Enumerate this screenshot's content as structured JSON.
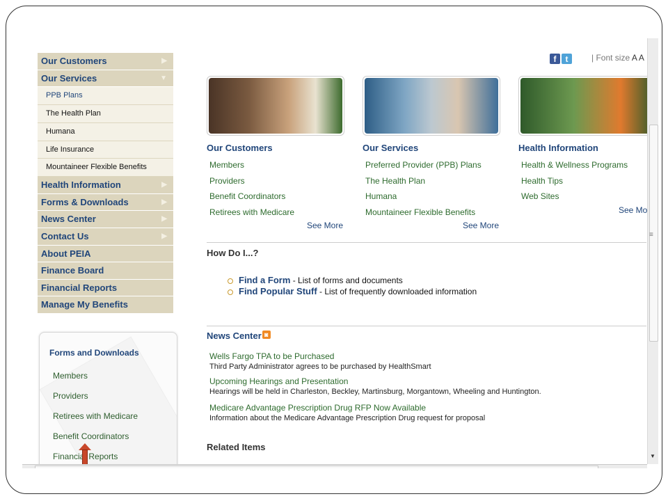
{
  "nav": {
    "items": [
      {
        "label": "Our Customers",
        "arrow": "▶"
      },
      {
        "label": "Our Services",
        "arrow": "▼"
      }
    ],
    "sub_items": [
      "PPB Plans",
      "The Health Plan",
      "Humana",
      "Life Insurance",
      "Mountaineer Flexible Benefits"
    ],
    "items_after": [
      {
        "label": "Health Information",
        "arrow": "▶"
      },
      {
        "label": "Forms & Downloads",
        "arrow": "▶"
      },
      {
        "label": "News Center",
        "arrow": "▶"
      },
      {
        "label": "Contact Us",
        "arrow": "▶"
      },
      {
        "label": "About PEIA",
        "arrow": ""
      },
      {
        "label": "Finance Board",
        "arrow": ""
      },
      {
        "label": "Financial Reports",
        "arrow": ""
      },
      {
        "label": "Manage My Benefits",
        "arrow": ""
      }
    ]
  },
  "forms_box": {
    "title": "Forms and Downloads",
    "links": [
      "Members",
      "Providers",
      "Retirees with Medicare",
      "Benefit Coordinators",
      "Financial Reports"
    ]
  },
  "social": {
    "facebook_glyph": "f",
    "twitter_glyph": "t",
    "font_size_label": "| Font size",
    "font_small": "A",
    "font_large": "A"
  },
  "columns": [
    {
      "title": "Our Customers",
      "links": [
        "Members",
        "Providers",
        "Benefit Coordinators",
        "Retirees with Medicare"
      ],
      "see_more": "See More",
      "photo_colors": [
        "#6b4b3a",
        "#c9a27c"
      ]
    },
    {
      "title": "Our Services",
      "links": [
        "Preferred Provider (PPB) Plans",
        "The Health Plan",
        "Humana",
        "Mountaineer Flexible Benefits"
      ],
      "see_more": "See More",
      "photo_colors": [
        "#3f6f9a",
        "#a9c4d8"
      ]
    },
    {
      "title": "Health Information",
      "links": [
        "Health & Wellness Programs",
        "Health Tips",
        "Web Sites"
      ],
      "see_more": "See Mo",
      "photo_colors": [
        "#2f5a2a",
        "#8db46a"
      ]
    }
  ],
  "how_do_i": {
    "title": "How Do I...?",
    "items": [
      {
        "link": "Find a Form",
        "desc": " - List of forms and documents"
      },
      {
        "link": "Find Popular Stuff",
        "desc": " - List of frequently downloaded information"
      }
    ]
  },
  "news": {
    "title": "News Center",
    "rss_glyph": "◙",
    "items": [
      {
        "title": "Wells Fargo TPA to be Purchased",
        "desc": "Third Party Administrator agrees to be purchased by HealthSmart"
      },
      {
        "title": "Upcoming Hearings and Presentation",
        "desc": "Hearings will be held in Charleston, Beckley, Martinsburg, Morgantown, Wheeling and Huntington."
      },
      {
        "title": "Medicare Advantage Prescription Drug RFP Now Available",
        "desc": "Information about the Medicare Advantage Prescription Drug request for proposal"
      }
    ]
  },
  "related": {
    "title": "Related Items"
  },
  "scrollbar": {
    "grip": "≡",
    "down": "▼"
  }
}
